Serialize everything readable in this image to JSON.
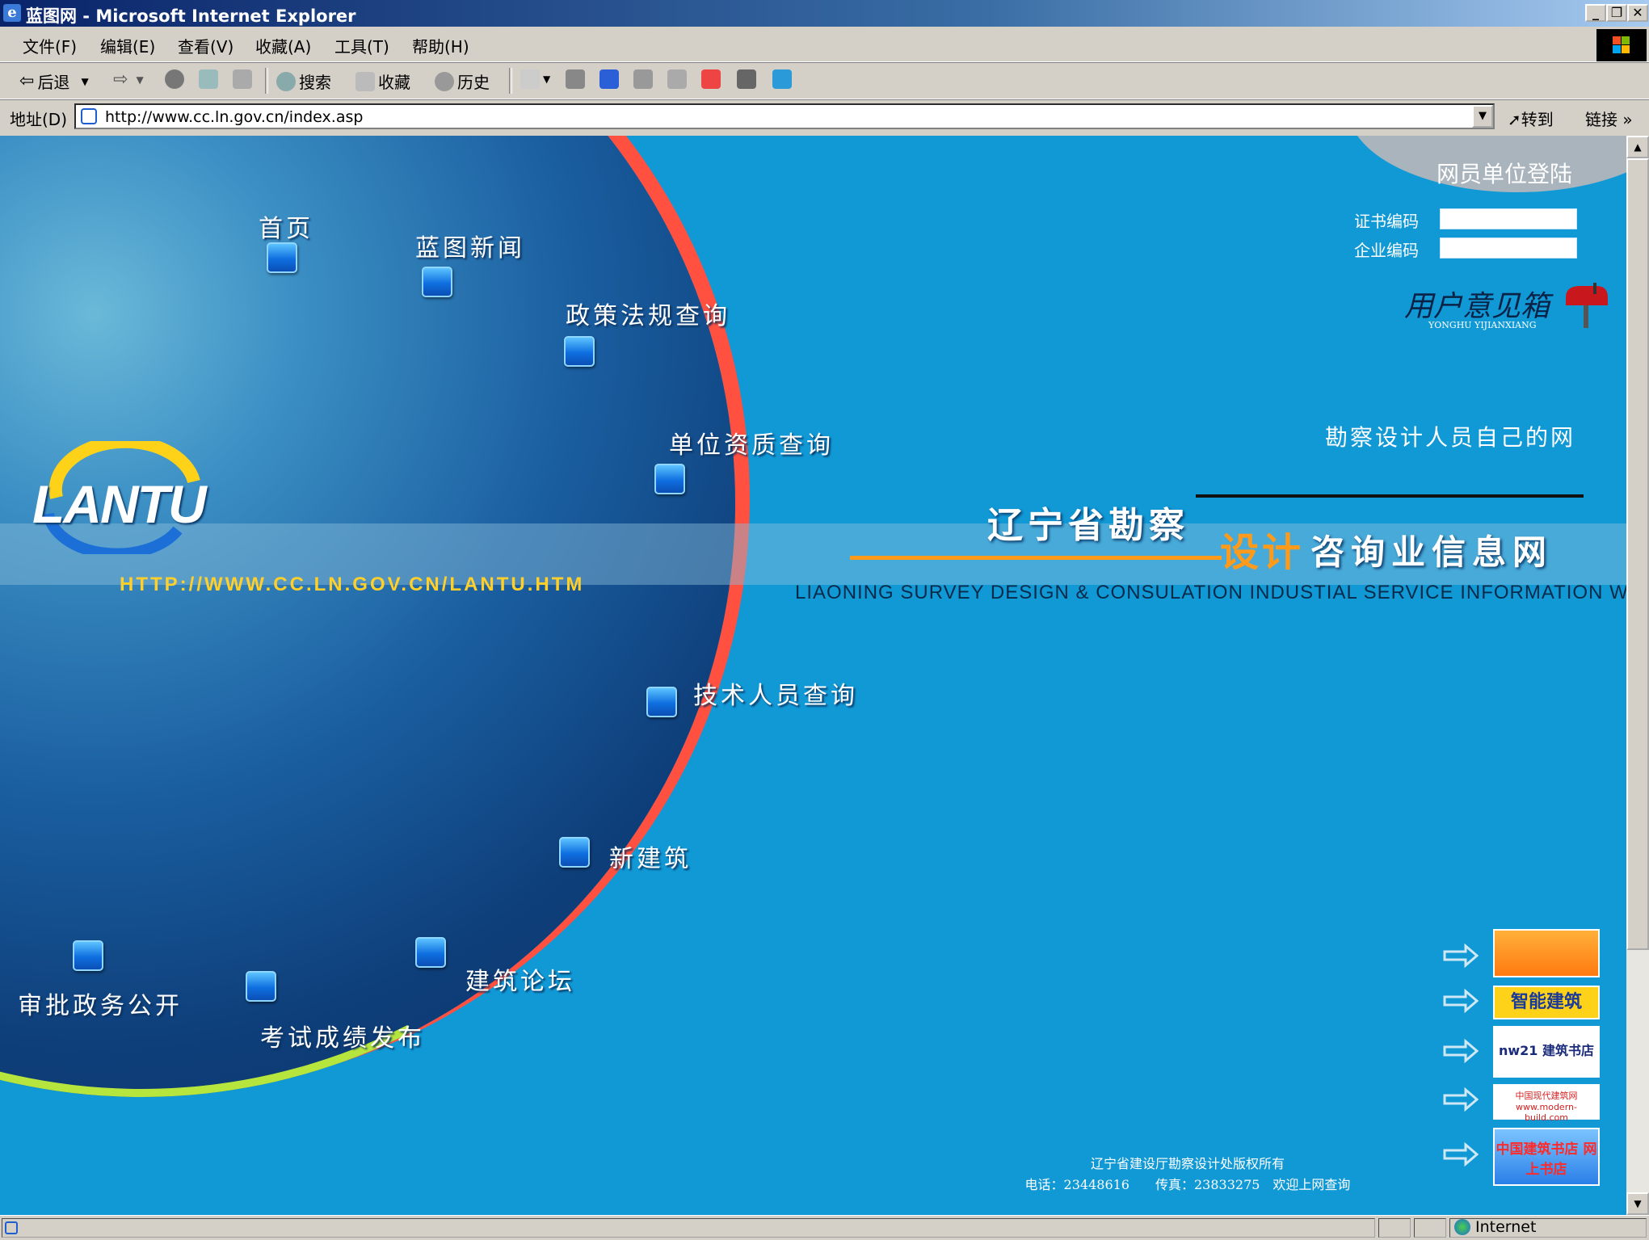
{
  "window": {
    "title": "蓝图网 - Microsoft Internet Explorer",
    "minimize": "_",
    "restore": "❐",
    "close": "✕"
  },
  "menu": {
    "items": [
      "文件(F)",
      "编辑(E)",
      "查看(V)",
      "收藏(A)",
      "工具(T)",
      "帮助(H)"
    ]
  },
  "toolbar": {
    "back": "后退",
    "search": "搜索",
    "favorites": "收藏",
    "history": "历史"
  },
  "address": {
    "label": "地址(D)",
    "url": "http://www.cc.ln.gov.cn/index.asp",
    "goto": "转到",
    "links": "链接"
  },
  "page": {
    "logo_text": "LANTU",
    "site_url": "HTTP://WWW.CC.LN.GOV.CN/LANTU.HTM",
    "nav": {
      "home": "首页",
      "news": "蓝图新闻",
      "policy": "政策法规查询",
      "qualification": "单位资质查询",
      "technician": "技术人员查询",
      "new_building": "新建筑",
      "forum": "建筑论坛",
      "exam": "考试成绩发布",
      "approval": "审批政务公开"
    },
    "login": {
      "title": "网员单位登陆",
      "cert_label": "证书编码",
      "corp_label": "企业编码",
      "cert_value": "",
      "corp_value": ""
    },
    "suggestion": {
      "title": "用户意见箱",
      "subtitle": "YONGHU YIJIANXIANG"
    },
    "tagline": "勘察设计人员自己的网",
    "title_part1": "辽宁省勘察",
    "title_part2": "设计",
    "title_part3": "咨询业信息网",
    "title_en": "LIAONING SURVEY DESIGN & CONSULATION INDUSTIAL SERVICE INFORMATION WEB",
    "partner_links": [
      {
        "label": "",
        "bg": "#ff9a1a"
      },
      {
        "label": "智能建筑",
        "bg": "#ffd21a"
      },
      {
        "label": "nw21 建筑书店",
        "bg": "#ffffff"
      },
      {
        "label": "中国现代建筑网 www.modern-build.com",
        "bg": "#ffffff"
      },
      {
        "label": "中国建筑书店 网上书店",
        "bg": "#3aa0ff"
      }
    ],
    "copyright_line1": "辽宁省建设厅勘察设计处版权所有",
    "copyright_line2": "电话：23448616　　传真：23833275　欢迎上网查询"
  },
  "status": {
    "zone": "Internet"
  },
  "colors": {
    "page_bg": "#1199d6",
    "accent_orange": "#ff9a1a",
    "url_yellow": "#ffcf2a"
  }
}
